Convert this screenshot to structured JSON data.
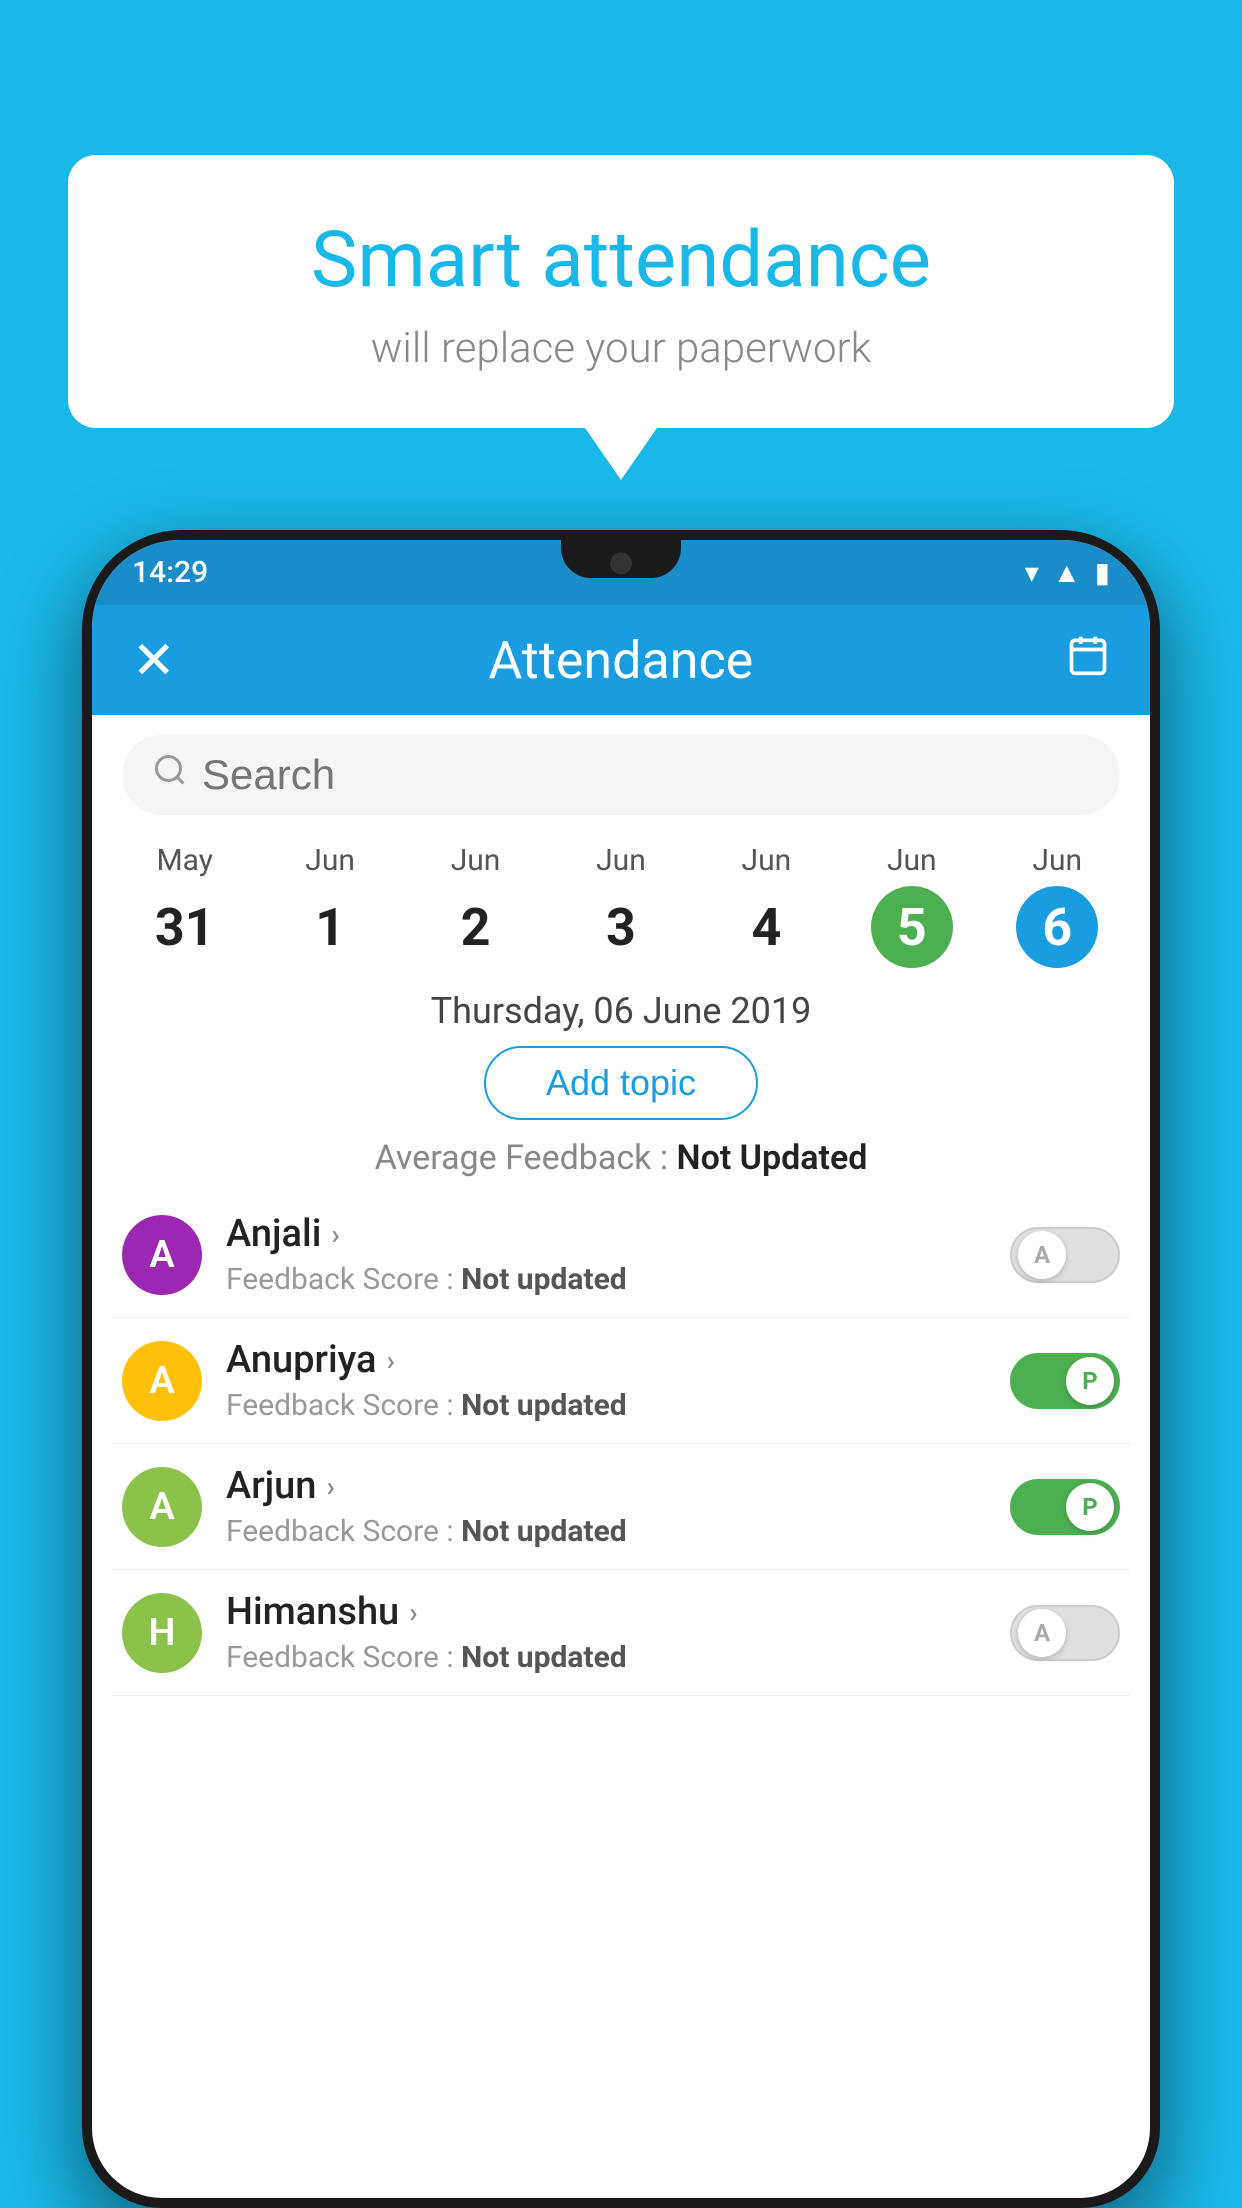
{
  "background_color": "#1ab8e8",
  "bubble": {
    "title": "Smart attendance",
    "subtitle": "will replace your paperwork"
  },
  "status_bar": {
    "time": "14:29",
    "icons": [
      "wifi",
      "signal",
      "battery"
    ]
  },
  "app_bar": {
    "title": "Attendance",
    "close_label": "×",
    "calendar_label": "📅"
  },
  "search": {
    "placeholder": "Search"
  },
  "calendar": {
    "days": [
      {
        "month": "May",
        "date": "31",
        "state": "normal"
      },
      {
        "month": "Jun",
        "date": "1",
        "state": "normal"
      },
      {
        "month": "Jun",
        "date": "2",
        "state": "normal"
      },
      {
        "month": "Jun",
        "date": "3",
        "state": "normal"
      },
      {
        "month": "Jun",
        "date": "4",
        "state": "normal"
      },
      {
        "month": "Jun",
        "date": "5",
        "state": "today"
      },
      {
        "month": "Jun",
        "date": "6",
        "state": "selected"
      }
    ]
  },
  "selected_date": "Thursday, 06 June 2019",
  "add_topic_label": "Add topic",
  "avg_feedback_label": "Average Feedback :",
  "avg_feedback_value": "Not Updated",
  "students": [
    {
      "name": "Anjali",
      "initial": "A",
      "avatar_color": "#9c27b0",
      "feedback": "Feedback Score : Not updated",
      "toggle": "off",
      "toggle_label": "A"
    },
    {
      "name": "Anupriya",
      "initial": "A",
      "avatar_color": "#ffc107",
      "feedback": "Feedback Score : Not updated",
      "toggle": "on",
      "toggle_label": "P"
    },
    {
      "name": "Arjun",
      "initial": "A",
      "avatar_color": "#8bc34a",
      "feedback": "Feedback Score : Not updated",
      "toggle": "on",
      "toggle_label": "P"
    },
    {
      "name": "Himanshu",
      "initial": "H",
      "avatar_color": "#8bc34a",
      "feedback": "Feedback Score : Not updated",
      "toggle": "off",
      "toggle_label": "A"
    }
  ]
}
